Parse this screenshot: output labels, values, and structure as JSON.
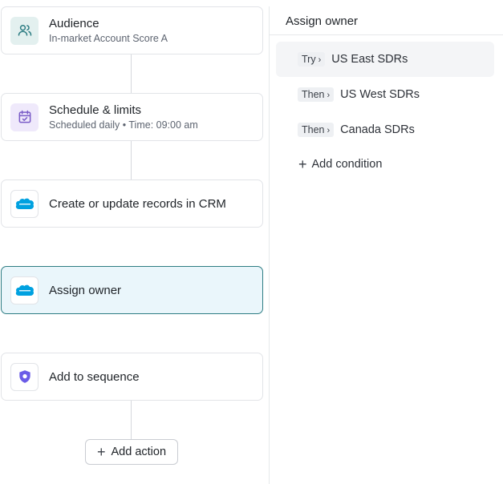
{
  "workflow": {
    "steps": [
      {
        "title": "Audience",
        "subtitle": "In-market Account Score A",
        "icon": "users-icon"
      },
      {
        "title": "Schedule & limits",
        "subtitle_a": "Scheduled daily",
        "subtitle_sep": "•",
        "subtitle_b": "Time: 09:00 am",
        "icon": "calendar-check-icon"
      },
      {
        "title": "Create or update records in CRM",
        "icon": "salesforce-logo"
      },
      {
        "title": "Assign owner",
        "icon": "salesforce-logo",
        "active": true
      },
      {
        "title": "Add to sequence",
        "icon": "sequence-shield-icon"
      }
    ],
    "add_action_label": "Add action"
  },
  "panel": {
    "title": "Assign owner",
    "rules": [
      {
        "prefix": "Try",
        "label": "US East SDRs"
      },
      {
        "prefix": "Then",
        "label": "US West SDRs"
      },
      {
        "prefix": "Then",
        "label": "Canada SDRs"
      }
    ],
    "add_condition_label": "Add condition"
  },
  "colors": {
    "accent": "#2e7d83",
    "active_bg": "#eaf6fb",
    "salesforce_blue": "#00a1e0",
    "sequence_purple": "#6b5ce7"
  }
}
